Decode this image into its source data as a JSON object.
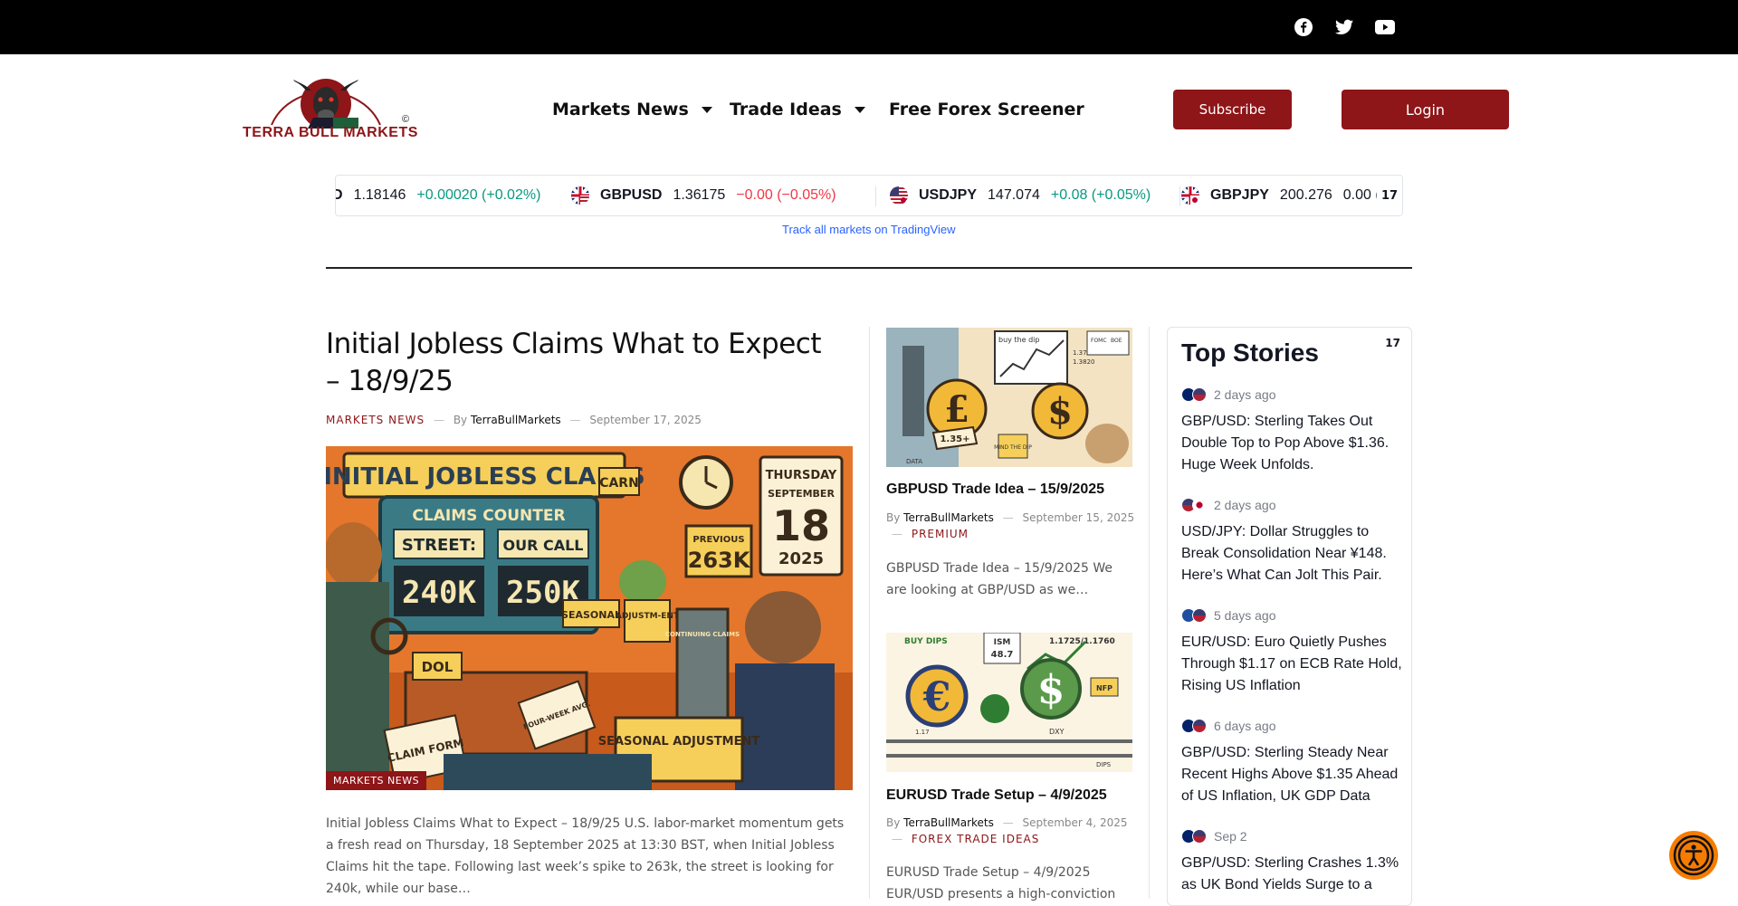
{
  "topbar": {
    "social": [
      {
        "name": "facebook-icon"
      },
      {
        "name": "twitter-icon"
      },
      {
        "name": "youtube-icon"
      }
    ]
  },
  "header": {
    "logo_text": "TERRA BULL MARKETS",
    "logo_mark": "©",
    "nav": [
      {
        "label": "Markets News",
        "dropdown": true
      },
      {
        "label": "Trade Ideas",
        "dropdown": true
      },
      {
        "label": "Free Forex Screener",
        "dropdown": false
      }
    ],
    "subscribe_label": "Subscribe",
    "login_label": "Login"
  },
  "ticker": {
    "items": [
      {
        "symbol": "D",
        "price": "1.18146",
        "change": "+0.00020 (+0.02%)",
        "direction": "up"
      },
      {
        "symbol": "GBPUSD",
        "price": "1.36175",
        "change": "−0.00 (−0.05%)",
        "direction": "down"
      },
      {
        "symbol": "USDJPY",
        "price": "147.074",
        "change": "+0.08 (+0.05%)",
        "direction": "up"
      },
      {
        "symbol": "GBPJPY",
        "price": "200.276",
        "change": "0.00 (",
        "direction": "flat"
      }
    ],
    "track_link": "Track all markets on TradingView",
    "tv_logo": "17"
  },
  "featured": {
    "title": "Initial Jobless Claims What to Expect – 18/9/25",
    "category": "MARKETS NEWS",
    "by": "By",
    "author": "TerraBullMarkets",
    "date": "September 17, 2025",
    "image_badge": "MARKETS NEWS",
    "excerpt": "Initial Jobless Claims What to Expect – 18/9/25 U.S. labor-market momentum gets a fresh read on Thursday, 18 September 2025 at 13:30 BST, when Initial Jobless Claims hit the tape. Following last week’s spike to 263k, the street is looking for 240k, while our base…",
    "image_text": {
      "banner": "INITIAL JOBLESS CLAIMS",
      "counter": "CLAIMS COUNTER",
      "street_label": "STREET:",
      "our_call_label": "OUR CALL",
      "street_value": "240K",
      "our_call_value": "250K",
      "previous": "PREVIOUS",
      "previous_value": "263K",
      "day": "THURSDAY",
      "month": "SEPTEMBER",
      "date": "18",
      "year": "2025",
      "dol": "DOL",
      "claim_form": "CLAIM FORM",
      "four_week": "FOUR-WEEK AVG.",
      "seasonal": "SEASONAL",
      "adjustment": "ADJUSTM-ENT",
      "continuing": "CONTINUING CLAIMS",
      "seasonal_adj": "SEASONAL ADJUSTMENT",
      "carn": "CARN"
    }
  },
  "cards": [
    {
      "title": "GBPUSD Trade Idea – 15/9/2025",
      "by": "By",
      "author": "TerraBullMarkets",
      "date": "September 15, 2025",
      "category": "PREMIUM",
      "excerpt": "GBPUSD Trade Idea – 15/9/2025 We are looking at GBP/USD as we…",
      "image_text": {
        "a": "buy the dip",
        "b": "1.3700",
        "c": "1.3820",
        "d": "FOMC",
        "e": "BOE",
        "f": "1.35+",
        "g": "MIND THE DIP",
        "h": "DATA"
      }
    },
    {
      "title": "EURUSD Trade Setup – 4/9/2025",
      "by": "By",
      "author": "TerraBullMarkets",
      "date": "September 4, 2025",
      "category": "FOREX TRADE IDEAS",
      "excerpt": "EURUSD Trade Setup – 4/9/2025 EUR/USD presents a high-conviction",
      "image_text": {
        "a": "BUY DIPS",
        "b": "ISM",
        "c": "48.7",
        "d": "1.1725/1.1760",
        "e": "NFP",
        "f": "DXY",
        "g": "DIPS",
        "h": "1.17"
      }
    }
  ],
  "top_stories": {
    "title": "Top Stories",
    "items": [
      {
        "time": "2 days ago",
        "headline": "GBP/USD: Sterling Takes Out Double Top to Pop Above $1.36. Huge Week Unfolds.",
        "flags": [
          "gb",
          "us"
        ]
      },
      {
        "time": "2 days ago",
        "headline": "USD/JPY: Dollar Struggles to Break Consolidation Near ¥148. Here’s What Can Jolt This Pair.",
        "flags": [
          "us",
          "jp"
        ]
      },
      {
        "time": "5 days ago",
        "headline": "EUR/USD: Euro Quietly Pushes Through $1.17 on ECB Rate Hold, Rising US Inflation",
        "flags": [
          "eu",
          "us"
        ]
      },
      {
        "time": "6 days ago",
        "headline": "GBP/USD: Sterling Steady Near Recent Highs Above $1.35 Ahead of US Inflation, UK GDP Data",
        "flags": [
          "gb",
          "us"
        ]
      },
      {
        "time": "Sep 2",
        "headline": "GBP/USD: Sterling Crashes 1.3% as UK Bond Yields Surge to a",
        "flags": [
          "gb",
          "us"
        ]
      }
    ]
  },
  "colors": {
    "brand_red": "#8e1518",
    "up": "#089981",
    "down": "#f23645",
    "accessibility": "#f57c00"
  }
}
